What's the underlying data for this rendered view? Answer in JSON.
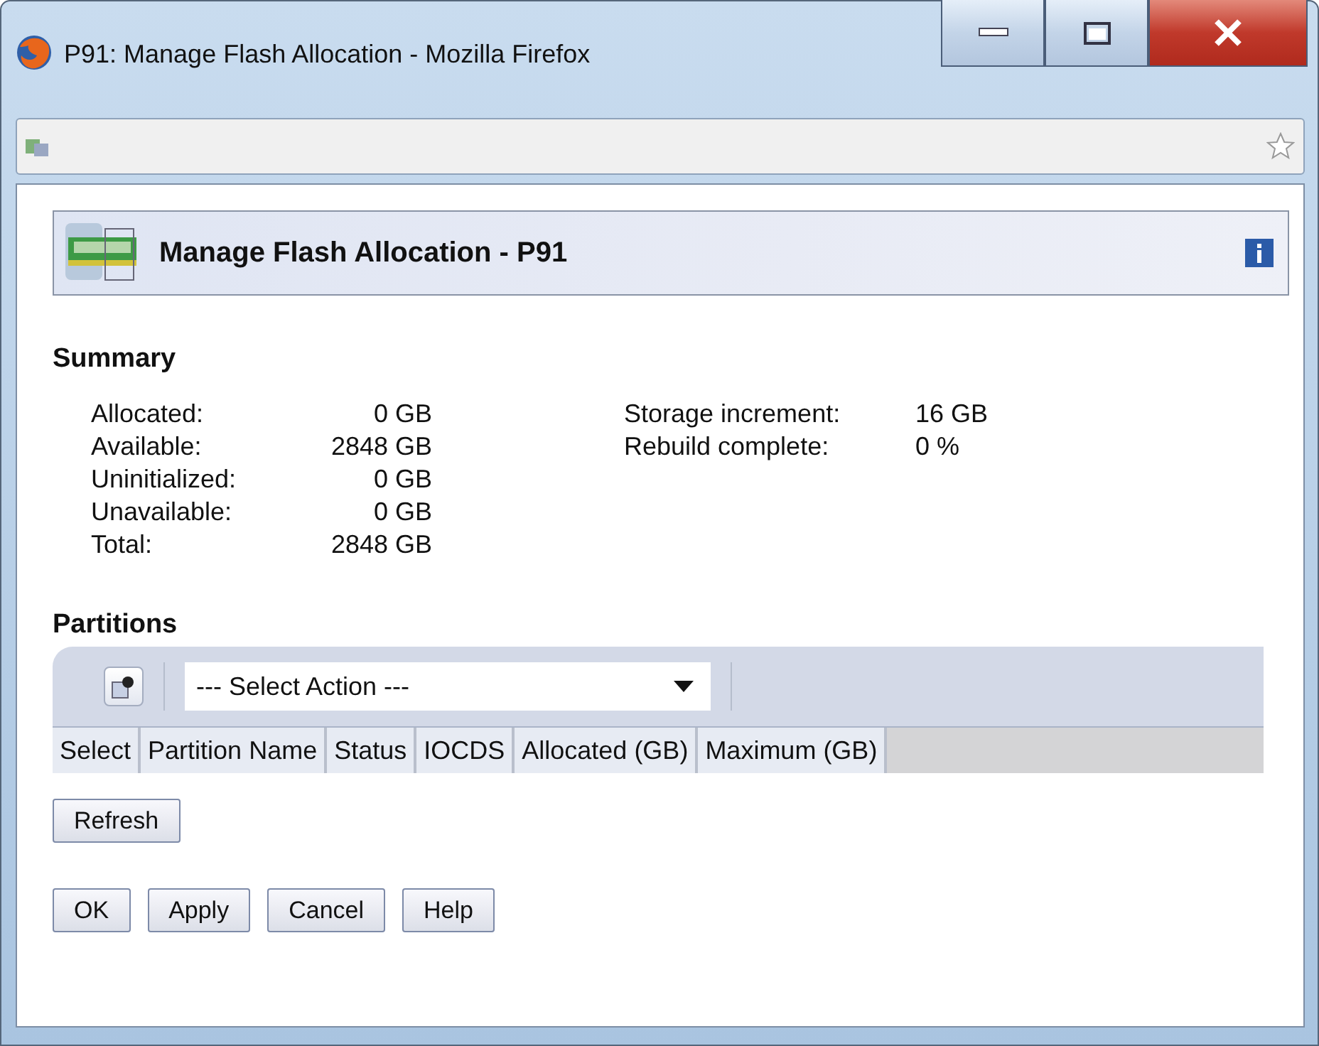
{
  "window": {
    "title": "P91: Manage Flash Allocation - Mozilla Firefox"
  },
  "header": {
    "title": "Manage Flash Allocation - P91"
  },
  "summary": {
    "heading": "Summary",
    "left": [
      {
        "label": "Allocated:",
        "value": "0 GB"
      },
      {
        "label": "Available:",
        "value": "2848 GB"
      },
      {
        "label": "Uninitialized:",
        "value": "0 GB"
      },
      {
        "label": "Unavailable:",
        "value": "0 GB"
      },
      {
        "label": "Total:",
        "value": "2848 GB"
      }
    ],
    "right": [
      {
        "label": "Storage increment:",
        "value": "16 GB"
      },
      {
        "label": "Rebuild complete:",
        "value": "0 %"
      }
    ]
  },
  "partitions": {
    "heading": "Partitions",
    "action_select": "--- Select Action ---",
    "columns": [
      "Select",
      "Partition Name",
      "Status",
      "IOCDS",
      "Allocated (GB)",
      "Maximum (GB)"
    ],
    "refresh": "Refresh"
  },
  "buttons": [
    "OK",
    "Apply",
    "Cancel",
    "Help"
  ]
}
